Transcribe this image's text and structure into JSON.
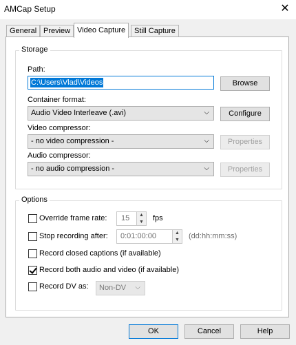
{
  "window": {
    "title": "AMCap Setup",
    "close_label": "✕"
  },
  "tabs": [
    {
      "label": "General"
    },
    {
      "label": "Preview"
    },
    {
      "label": "Video Capture"
    },
    {
      "label": "Still Capture"
    }
  ],
  "storage": {
    "group_label": "Storage",
    "path_label": "Path:",
    "path_value": "C:\\Users\\Vlad\\Videos",
    "browse_label": "Browse",
    "container_label": "Container format:",
    "container_value": "Audio Video Interleave (.avi)",
    "configure_label": "Configure",
    "video_comp_label": "Video compressor:",
    "video_comp_value": "- no video compression -",
    "audio_comp_label": "Audio compressor:",
    "audio_comp_value": "- no audio compression -",
    "properties_label": "Properties"
  },
  "options": {
    "group_label": "Options",
    "override_frame_rate_label": "Override frame rate:",
    "override_frame_rate_checked": false,
    "frame_rate_value": "15",
    "fps_label": "fps",
    "stop_recording_label": "Stop recording after:",
    "stop_recording_checked": false,
    "stop_time_value": "0:01:00:00",
    "stop_time_format": "(dd:hh:mm:ss)",
    "closed_captions_label": "Record closed captions (if available)",
    "closed_captions_checked": false,
    "audio_video_label": "Record both audio and video (if available)",
    "audio_video_checked": true,
    "record_dv_label": "Record DV as:",
    "record_dv_checked": false,
    "record_dv_value": "Non-DV"
  },
  "footer": {
    "ok_label": "OK",
    "cancel_label": "Cancel",
    "help_label": "Help"
  }
}
